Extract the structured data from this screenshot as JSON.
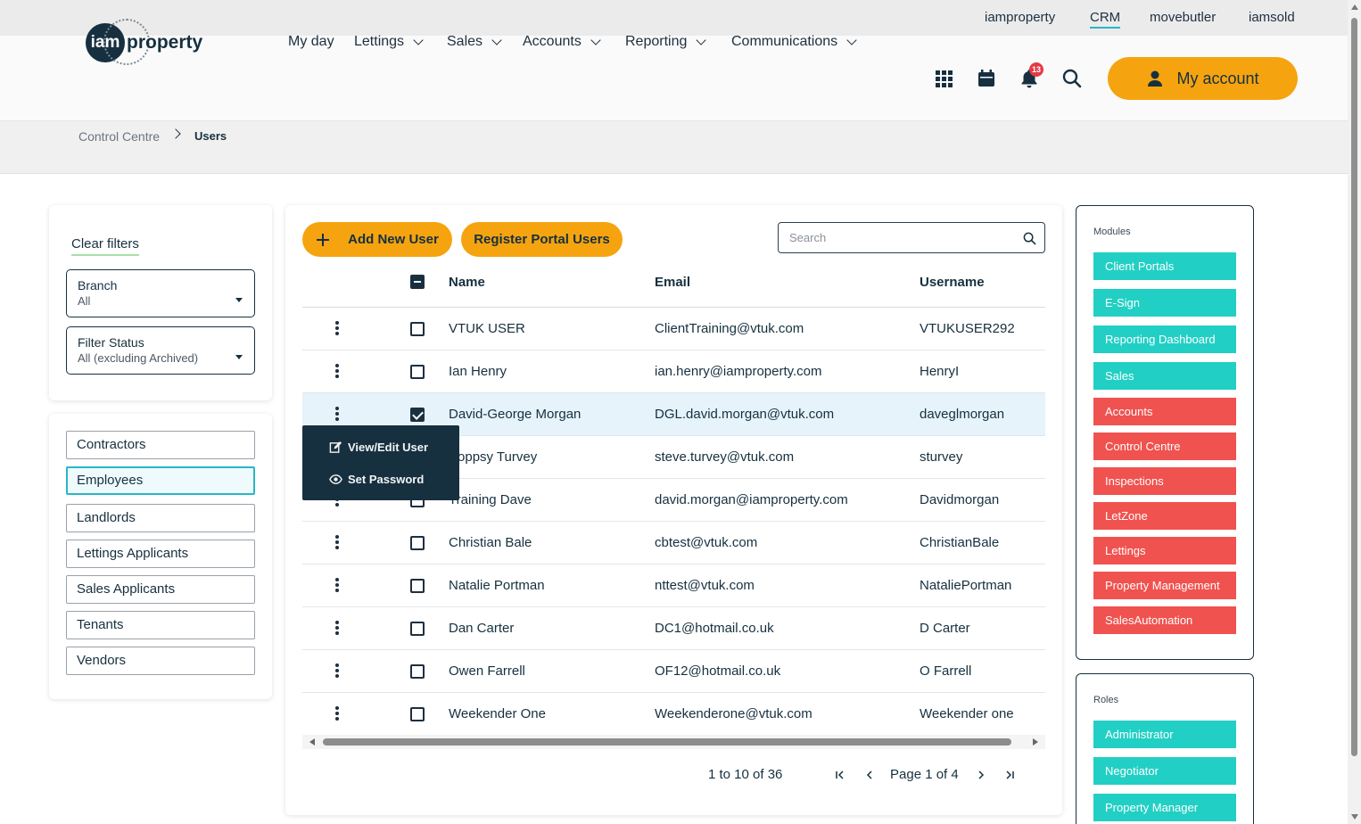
{
  "topbar": {
    "links": [
      "iamproperty",
      "CRM",
      "movebutler",
      "iamsold"
    ],
    "active": "CRM"
  },
  "header": {
    "logo": {
      "left": "iam",
      "right": "property"
    },
    "nav": [
      "My day",
      "Lettings",
      "Sales",
      "Accounts",
      "Reporting",
      "Communications"
    ],
    "notification_count": "13",
    "account_label": "My account",
    "accent_color": "#f5a40f"
  },
  "breadcrumb": {
    "parent": "Control Centre",
    "current": "Users"
  },
  "filters": {
    "clear_label": "Clear filters",
    "branch": {
      "label": "Branch",
      "value": "All"
    },
    "status": {
      "label": "Filter Status",
      "value": "All (excluding Archived)"
    }
  },
  "contact_types": {
    "items": [
      "Contractors",
      "Employees",
      "Landlords",
      "Lettings Applicants",
      "Sales Applicants",
      "Tenants",
      "Vendors"
    ],
    "active": "Employees"
  },
  "toolbar": {
    "add_user": "Add New User",
    "register_portal": "Register Portal Users",
    "search_placeholder": "Search"
  },
  "table": {
    "columns": [
      "Name",
      "Email",
      "Username"
    ],
    "rows": [
      {
        "name": "VTUK USER",
        "email": "ClientTraining@vtuk.com",
        "username": "VTUKUSER292",
        "checked": false
      },
      {
        "name": "Ian Henry",
        "email": "ian.henry@iamproperty.com",
        "username": "HenryI",
        "checked": false
      },
      {
        "name": "David-George Morgan",
        "email": "DGL.david.morgan@vtuk.com",
        "username": "daveglmorgan",
        "checked": true
      },
      {
        "name": "Poppsy Turvey",
        "email": "steve.turvey@vtuk.com",
        "username": "sturvey",
        "checked": false
      },
      {
        "name": "Training Dave",
        "email": "david.morgan@iamproperty.com",
        "username": "Davidmorgan",
        "checked": false
      },
      {
        "name": "Christian Bale",
        "email": "cbtest@vtuk.com",
        "username": "ChristianBale",
        "checked": false
      },
      {
        "name": "Natalie Portman",
        "email": "nttest@vtuk.com",
        "username": "NataliePortman",
        "checked": false
      },
      {
        "name": "Dan Carter",
        "email": "DC1@hotmail.co.uk",
        "username": "D Carter",
        "checked": false
      },
      {
        "name": "Owen Farrell",
        "email": "OF12@hotmail.co.uk",
        "username": "O Farrell",
        "checked": false
      },
      {
        "name": "Weekender One",
        "email": "Weekenderone@vtuk.com",
        "username": "Weekender one",
        "checked": false
      }
    ]
  },
  "context_menu": {
    "edit": "View/Edit User",
    "password": "Set Password"
  },
  "pagination": {
    "range": "1 to 10 of 36",
    "page": "Page 1 of 4"
  },
  "modules": {
    "heading": "Modules",
    "items": [
      {
        "label": "Client Portals",
        "enabled": true
      },
      {
        "label": "E-Sign",
        "enabled": true
      },
      {
        "label": "Reporting Dashboard",
        "enabled": true
      },
      {
        "label": "Sales",
        "enabled": true
      },
      {
        "label": "Accounts",
        "enabled": false
      },
      {
        "label": "Control Centre",
        "enabled": false
      },
      {
        "label": "Inspections",
        "enabled": false
      },
      {
        "label": "LetZone",
        "enabled": false
      },
      {
        "label": "Lettings",
        "enabled": false
      },
      {
        "label": "Property Management",
        "enabled": false
      },
      {
        "label": "SalesAutomation",
        "enabled": false
      }
    ],
    "enabled_color": "#22cfc4",
    "disabled_color": "#f0524f"
  },
  "roles": {
    "heading": "Roles",
    "items": [
      "Administrator",
      "Negotiator",
      "Property Manager"
    ]
  }
}
